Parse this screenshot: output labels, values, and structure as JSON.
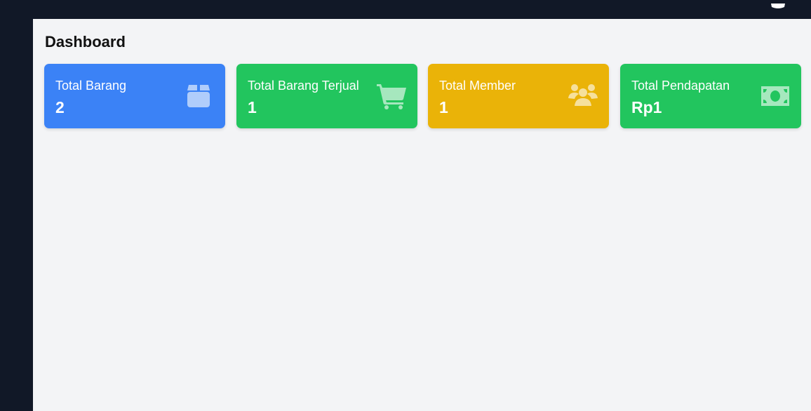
{
  "page": {
    "title": "Dashboard"
  },
  "cards": [
    {
      "label": "Total Barang",
      "value": "2",
      "color": "#3b82f6",
      "icon": "box-icon"
    },
    {
      "label": "Total Barang Terjual",
      "value": "1",
      "color": "#22c55e",
      "icon": "shopping-cart-icon"
    },
    {
      "label": "Total Member",
      "value": "1",
      "color": "#eab308",
      "icon": "users-icon"
    },
    {
      "label": "Total Pendapatan",
      "value": "Rp1",
      "color": "#22c55e",
      "icon": "money-bill-icon"
    }
  ],
  "colors": {
    "topbar": "#111827",
    "sidebar": "#111827",
    "main_background": "#f3f4f6"
  }
}
